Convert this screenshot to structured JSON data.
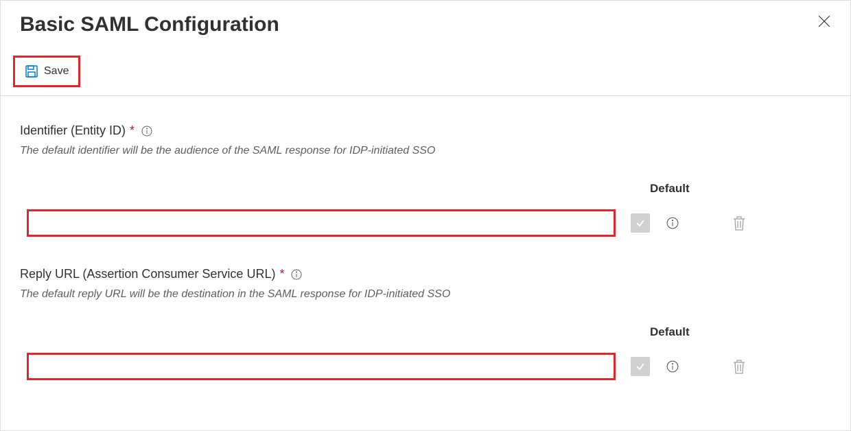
{
  "header": {
    "title": "Basic SAML Configuration"
  },
  "toolbar": {
    "save_label": "Save"
  },
  "identifier": {
    "label": "Identifier (Entity ID)",
    "required": "*",
    "description": "The default identifier will be the audience of the SAML response for IDP-initiated SSO",
    "default_header": "Default",
    "value": ""
  },
  "replyUrl": {
    "label": "Reply URL (Assertion Consumer Service URL)",
    "required": "*",
    "description": "The default reply URL will be the destination in the SAML response for IDP-initiated SSO",
    "default_header": "Default",
    "value": ""
  }
}
